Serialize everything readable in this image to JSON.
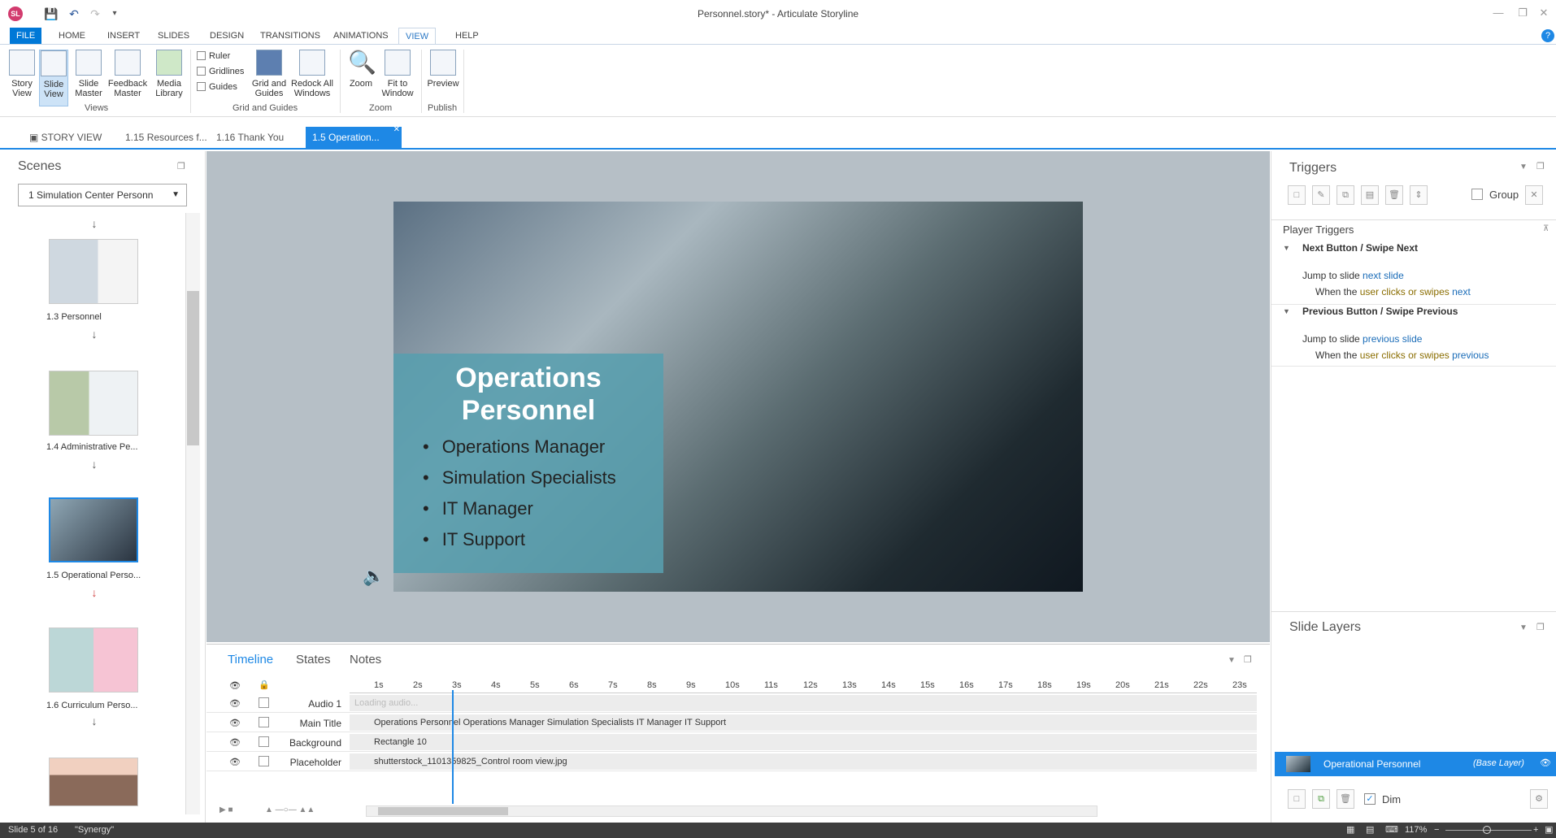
{
  "app": {
    "icon_text": "SL",
    "title": "Personnel.story* - Articulate Storyline"
  },
  "ribbon_tabs": [
    "FILE",
    "HOME",
    "INSERT",
    "SLIDES",
    "DESIGN",
    "TRANSITIONS",
    "ANIMATIONS",
    "VIEW",
    "HELP"
  ],
  "ribbon": {
    "story_view": "Story View",
    "slide_view": "Slide View",
    "slide_master": "Slide Master",
    "feedback_master": "Feedback Master",
    "media_library": "Media Library",
    "views_group": "Views",
    "ruler": "Ruler",
    "gridlines": "Gridlines",
    "guides": "Guides",
    "grid_and_guides": "Grid and Guides",
    "redock": "Redock All Windows",
    "grid_group": "Grid and Guides",
    "zoom": "Zoom",
    "fit": "Fit to Window",
    "zoom_group": "Zoom",
    "preview": "Preview",
    "publish_group": "Publish"
  },
  "doc_tabs": {
    "story_view": "STORY VIEW",
    "tab1": "1.15 Resources f...",
    "tab2": "1.16 Thank You",
    "tab3": "1.5 Operation..."
  },
  "scenes": {
    "title": "Scenes",
    "selected": "1 Simulation Center Personn",
    "slides": [
      {
        "label": "1.3 Personnel"
      },
      {
        "label": "1.4 Administrative Pe..."
      },
      {
        "label": "1.5 Operational Perso..."
      },
      {
        "label": "1.6 Curriculum Perso..."
      }
    ]
  },
  "slide": {
    "title": "Operations Personnel",
    "bullets": [
      "Operations Manager",
      "Simulation Specialists",
      "IT Manager",
      "IT Support"
    ]
  },
  "timeline": {
    "tabs": [
      "Timeline",
      "States",
      "Notes"
    ],
    "ticks": [
      "1s",
      "2s",
      "3s",
      "4s",
      "5s",
      "6s",
      "7s",
      "8s",
      "9s",
      "10s",
      "11s",
      "12s",
      "13s",
      "14s",
      "15s",
      "16s",
      "17s",
      "18s",
      "19s",
      "20s",
      "21s",
      "22s",
      "23s"
    ],
    "rows": [
      {
        "name": "Audio 1",
        "content": "Loading audio..."
      },
      {
        "name": "Main Title",
        "content": "Operations Personnel Operations Manager Simulation Specialists IT Manager IT Support"
      },
      {
        "name": "Background",
        "content": "Rectangle 10"
      },
      {
        "name": "Placeholder",
        "content": "shutterstock_1101359825_Control room view.jpg"
      }
    ]
  },
  "triggers": {
    "title": "Triggers",
    "group_label": "Group",
    "player_triggers": "Player Triggers",
    "next_header": "Next Button / Swipe Next",
    "next_action": "Jump to slide",
    "next_target": "next slide",
    "next_when": "When the",
    "next_user": "user clicks or swipes",
    "next_obj": "next",
    "prev_header": "Previous Button / Swipe Previous",
    "prev_action": "Jump to slide",
    "prev_target": "previous slide",
    "prev_when": "When the",
    "prev_user": "user clicks or swipes",
    "prev_obj": "previous"
  },
  "layers": {
    "title": "Slide Layers",
    "base_name": "Operational Personnel",
    "base_tag": "(Base Layer)",
    "dim_label": "Dim"
  },
  "status": {
    "slide": "Slide 5 of 16",
    "theme": "\"Synergy\"",
    "zoom": "117%"
  },
  "colors": {
    "accent": "#1e88e5",
    "file_tab": "#0078d7",
    "panel": "#589eae"
  }
}
